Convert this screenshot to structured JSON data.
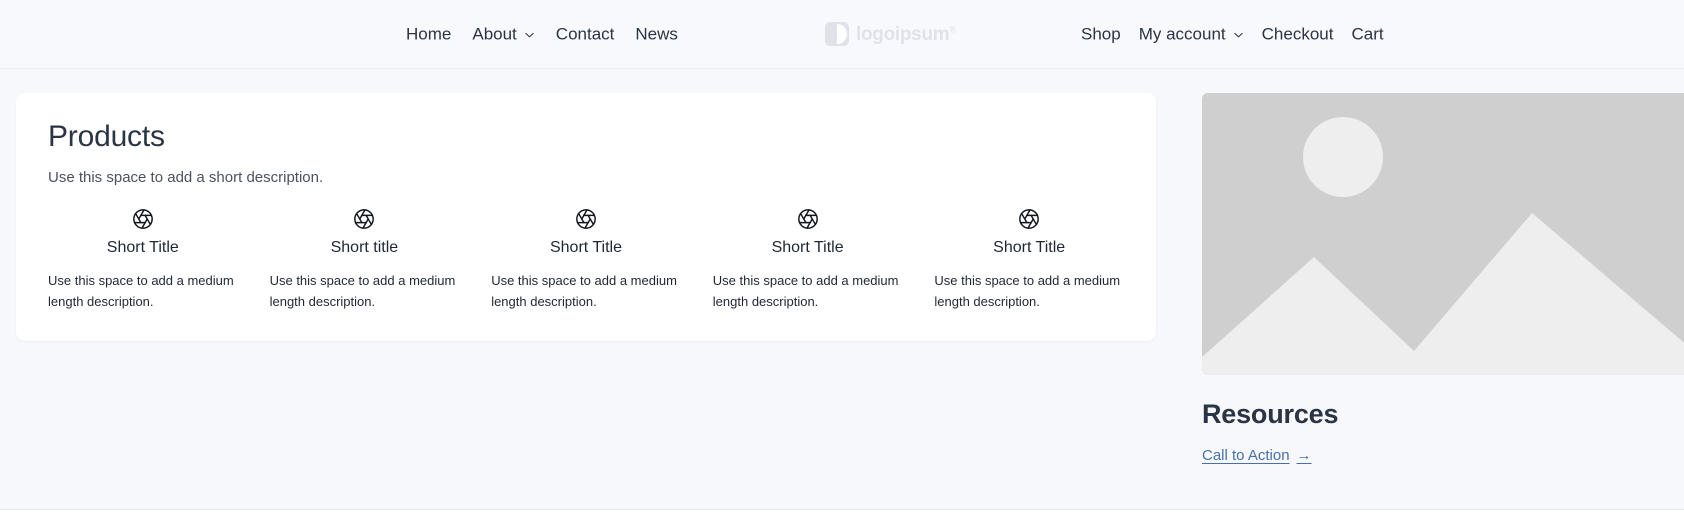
{
  "header": {
    "nav_left": [
      {
        "label": "Home",
        "has_dropdown": false
      },
      {
        "label": "About",
        "has_dropdown": true
      },
      {
        "label": "Contact",
        "has_dropdown": false
      },
      {
        "label": "News",
        "has_dropdown": false
      }
    ],
    "nav_right": [
      {
        "label": "Shop",
        "has_dropdown": false
      },
      {
        "label": "My account",
        "has_dropdown": true
      },
      {
        "label": "Checkout",
        "has_dropdown": false
      },
      {
        "label": "Cart",
        "has_dropdown": false
      }
    ],
    "logo": {
      "text": "logoipsum",
      "registered": "®",
      "icon": "logo-circle-mark"
    }
  },
  "products": {
    "title": "Products",
    "subtitle": "Use this space to add a short description.",
    "cards": [
      {
        "icon": "aperture-icon",
        "title": "Short Title",
        "description": "Use this space to add a medium length description."
      },
      {
        "icon": "aperture-icon",
        "title": "Short title",
        "description": "Use this space to add a medium length description."
      },
      {
        "icon": "aperture-icon",
        "title": "Short Title",
        "description": "Use this space to add a medium length description."
      },
      {
        "icon": "aperture-icon",
        "title": "Short Title",
        "description": "Use this space to add a medium length description."
      },
      {
        "icon": "aperture-icon",
        "title": "Short Title",
        "description": "Use this space to add a medium length description."
      }
    ]
  },
  "resources": {
    "image_placeholder": "image-placeholder-icon",
    "title": "Resources",
    "cta_label": "Call to Action",
    "cta_arrow": "→"
  },
  "colors": {
    "page_background": "#f6f8fb",
    "header_background": "#f7f9fc",
    "card_background": "#ffffff",
    "text_primary": "#2b3445",
    "link": "#4a6fa5",
    "placeholder_gray": "#cfcfcf",
    "placeholder_light": "#eeeeee"
  }
}
